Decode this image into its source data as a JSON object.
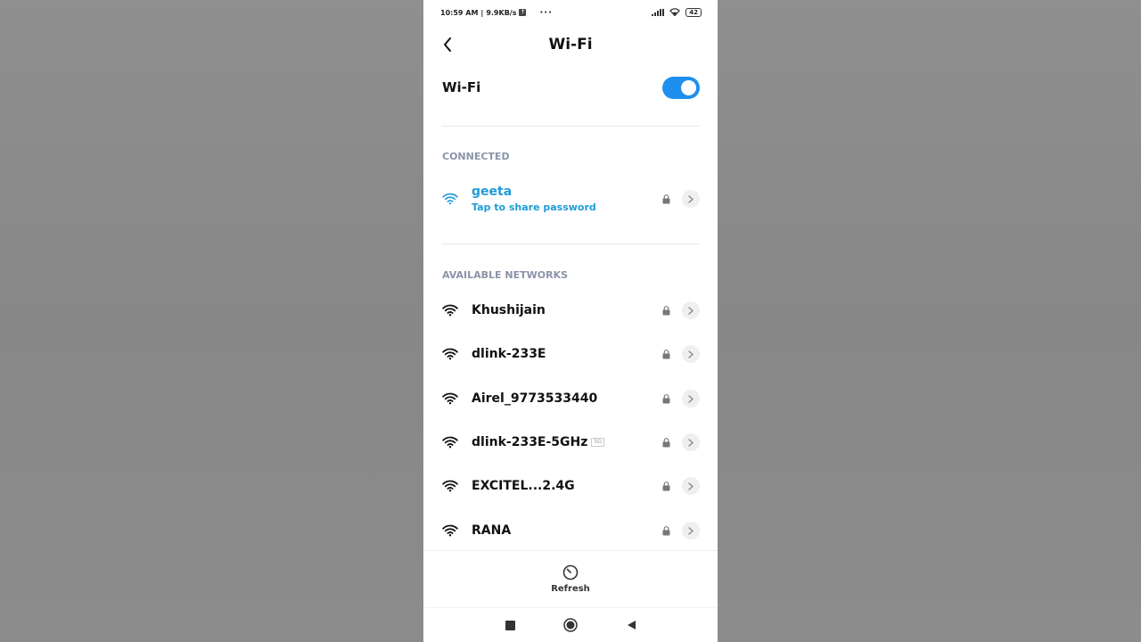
{
  "status_bar": {
    "time": "10:59 AM",
    "speed": "9.9KB/s",
    "dots": "···",
    "battery": "42"
  },
  "header": {
    "title": "Wi-Fi"
  },
  "wifi_toggle": {
    "label": "Wi-Fi",
    "enabled": true,
    "accent_color": "#1e8fef"
  },
  "connected": {
    "section_label": "CONNECTED",
    "network": {
      "name": "geeta",
      "subtitle": "Tap to share password",
      "secured": true,
      "color": "#1e9bd7"
    }
  },
  "available": {
    "section_label": "AVAILABLE NETWORKS",
    "networks": [
      {
        "name": "Khushijain",
        "tag": "",
        "secured": true
      },
      {
        "name": "dlink-233E",
        "tag": "",
        "secured": true
      },
      {
        "name": "Airel_9773533440",
        "tag": "",
        "secured": true
      },
      {
        "name": "dlink-233E-5GHz",
        "tag": "5G",
        "secured": true
      },
      {
        "name": "EXCITEL...2.4G",
        "tag": "",
        "secured": true
      },
      {
        "name": "RANA",
        "tag": "",
        "secured": true
      }
    ]
  },
  "refresh": {
    "label": "Refresh"
  }
}
